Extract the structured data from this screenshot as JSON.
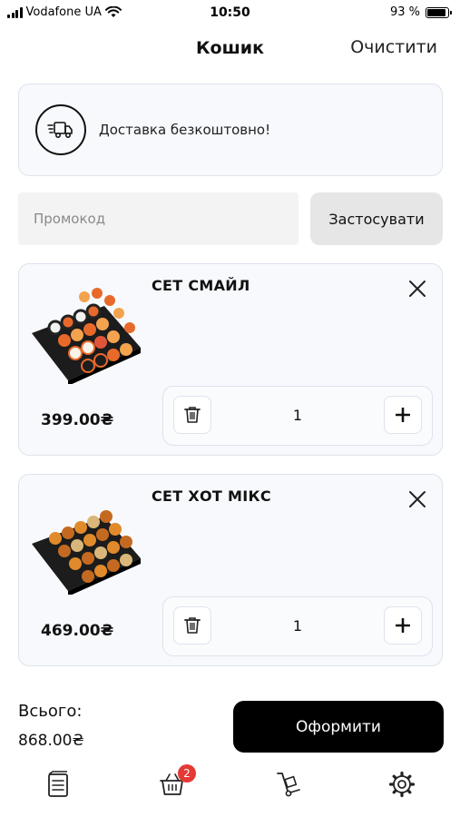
{
  "status_bar": {
    "carrier": "Vodafone UA",
    "time": "10:50",
    "battery": "93 %",
    "battery_level": 0.93
  },
  "header": {
    "title": "Кошик",
    "clear_label": "Очистити"
  },
  "delivery": {
    "text": "Доставка безкоштовно!",
    "icon": "delivery-truck-icon"
  },
  "promo": {
    "placeholder": "Промокод",
    "value": "",
    "apply_label": "Застосувати"
  },
  "items": [
    {
      "name": "СЕТ СМАЙЛ",
      "price": "399.00₴",
      "quantity": "1"
    },
    {
      "name": "СЕТ ХОТ МІКС",
      "price": "469.00₴",
      "quantity": "1"
    }
  ],
  "total": {
    "label": "Всього:",
    "value": "868.00₴"
  },
  "checkout_label": "Оформити",
  "tab_bar": {
    "tabs": [
      {
        "icon": "menu-list-icon"
      },
      {
        "icon": "basket-icon",
        "badge": "2"
      },
      {
        "icon": "hand-truck-icon"
      },
      {
        "icon": "settings-gear-icon"
      }
    ]
  },
  "colors": {
    "accent": "#000000",
    "badge": "#e53935",
    "card_bg": "#f7f9fc",
    "card_border": "#dde3ec"
  }
}
